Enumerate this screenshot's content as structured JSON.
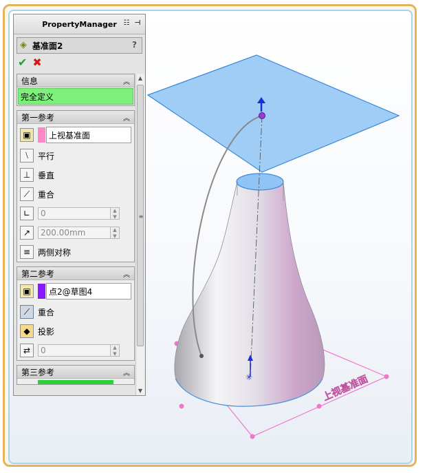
{
  "panel": {
    "title": "PropertyManager",
    "feature_name": "基准面2",
    "help": "?",
    "ok_symbol": "✔",
    "cancel_symbol": "✖"
  },
  "info_group": {
    "header": "信息",
    "status": "完全定义",
    "status_color": "#7cf07a"
  },
  "ref1": {
    "header": "第一参考",
    "selection": "上视基准面",
    "selection_color": "#ff88c8",
    "options": {
      "parallel": "平行",
      "perpendicular": "垂直",
      "coincident": "重合",
      "symmetric": "两侧对称"
    },
    "angle_value": "0",
    "distance_value": "200.00mm"
  },
  "ref2": {
    "header": "第二参考",
    "selection": "点2@草图4",
    "selection_color": "#8a18ff",
    "options": {
      "coincident": "重合",
      "project": "投影"
    },
    "offset_value": "0"
  },
  "ref3": {
    "header": "第三参考"
  },
  "scene": {
    "plane_label": "上视基准面",
    "plane_color": "#8fc4f4",
    "sketch_color": "#ee77cc"
  }
}
